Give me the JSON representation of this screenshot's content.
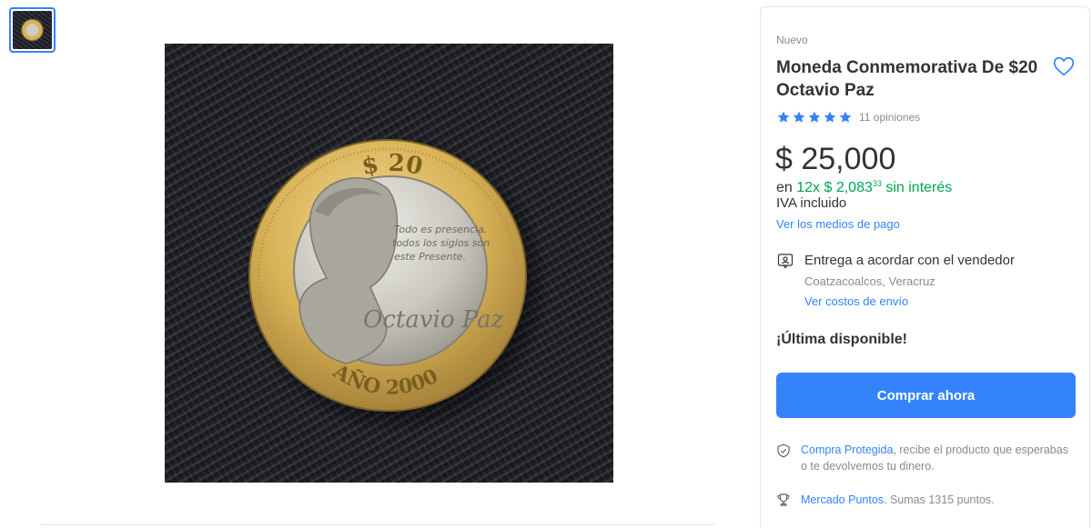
{
  "gallery": {
    "thumbnail_alt": "coin-thumbnail",
    "coin_text": {
      "denomination": "$ 20",
      "quote_line1": "Todo es presencia,",
      "quote_line2": "todos los siglos son",
      "quote_line3": "este Presente.",
      "signature": "Octavio Paz",
      "year": "AÑO 2000"
    }
  },
  "product": {
    "condition": "Nuevo",
    "title": "Moneda Conmemorativa De $20 Octavio Paz",
    "rating": 5,
    "reviews": "11 opiniones",
    "price": "$ 25,000",
    "installments_prefix": "en ",
    "installments_amount": "12x $ 2,083",
    "installments_cents": "33",
    "installments_suffix": " sin interés",
    "iva": "IVA incluido",
    "payment_link": "Ver los medios de pago"
  },
  "delivery": {
    "title": "Entrega a acordar con el vendedor",
    "location": "Coatzacoalcos, Veracruz",
    "shipping_link": "Ver costos de envío"
  },
  "stock": "¡Última disponible!",
  "buy_button": "Comprar ahora",
  "benefits": {
    "protected_link": "Compra Protegida",
    "protected_text": ", recibe el producto que esperabas o te devolvemos tu dinero.",
    "points_link": "Mercado Puntos.",
    "points_text": " Sumas 1315 puntos."
  },
  "colors": {
    "accent": "#3483fa",
    "green": "#00a650"
  },
  "icons": {
    "favorite": "heart-icon",
    "star": "star-icon",
    "delivery": "delivery-agreement-icon",
    "protected": "shield-check-icon",
    "points": "trophy-icon"
  }
}
